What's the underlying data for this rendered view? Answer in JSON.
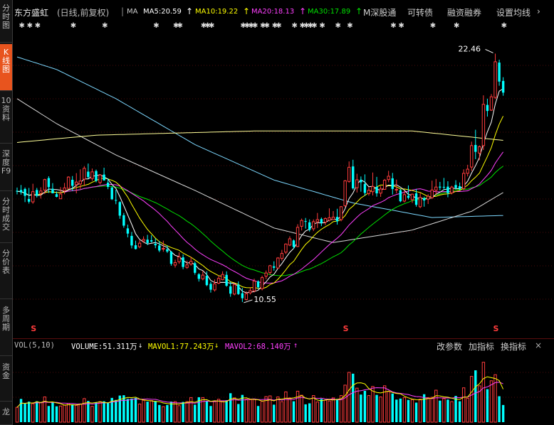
{
  "sidebar": {
    "tabs": [
      {
        "label": "分时图",
        "active": false
      },
      {
        "label": "K线图",
        "active": true
      },
      {
        "label": "10资料",
        "active": false
      },
      {
        "label": "深度F9",
        "active": false
      },
      {
        "label": "分时成交",
        "active": false
      },
      {
        "label": "分价表",
        "active": false
      },
      {
        "label": "多周期",
        "active": false
      },
      {
        "label": "资金",
        "active": false
      },
      {
        "label": "龙",
        "active": false
      }
    ]
  },
  "header": {
    "stock_name": "东方盛虹",
    "period": "(日线,前复权)",
    "ma_label": "MA",
    "ma5": "MA5:20.59",
    "ma10": "MA10:19.22",
    "ma20": "MA20:18.13",
    "ma30": "MA30:17.89",
    "ma5_arrow": "↑",
    "ma10_arrow": "↑",
    "ma20_arrow": "↑",
    "ma30_arrow": "↑",
    "menu_1": "M深股通",
    "menu_2": "可转债",
    "menu_3": "融资融券",
    "menu_4": "设置均线"
  },
  "volume_bar": {
    "label": "VOL(5,10)",
    "volume": "VOLUME:51.311万",
    "volume_arrow": "↓",
    "mavol1": "MAVOL1:77.243万",
    "mavol1_arrow": "↓",
    "mavol2": "MAVOL2:68.140万",
    "mavol2_arrow": "↑",
    "btn_params": "改参数",
    "btn_add": "加指标",
    "btn_switch": "换指标"
  },
  "colors": {
    "up": "#ff3c3c",
    "down": "#00ffff",
    "ma5": "#ffffff",
    "ma10": "#ffff00",
    "ma20": "#ff40ff",
    "ma30": "#00e000",
    "ma60": "#ffff99",
    "ma120": "#7dd8ff",
    "ma250": "#d8d8d8"
  },
  "chart_data": {
    "type": "candlestick",
    "title": "东方盛虹",
    "ylim": [
      9.9,
      23.6
    ],
    "annotations": [
      {
        "label": "22.46",
        "type": "high"
      },
      {
        "label": "10.55",
        "type": "low"
      }
    ],
    "s_markers": [
      "S",
      "S",
      "S"
    ],
    "candles": [
      [
        15.88,
        16.04,
        15.71,
        15.86
      ],
      [
        15.92,
        16.16,
        15.7,
        15.81
      ],
      [
        15.97,
        16.04,
        15.34,
        15.64
      ],
      [
        15.49,
        16.02,
        15.27,
        15.36
      ],
      [
        15.35,
        16.22,
        15.26,
        15.84
      ],
      [
        15.92,
        16.02,
        15.56,
        15.64
      ],
      [
        15.76,
        16.05,
        15.51,
        15.87
      ],
      [
        15.92,
        16.46,
        15.73,
        16.42
      ],
      [
        16.49,
        16.58,
        15.78,
        16.06
      ],
      [
        15.98,
        16.25,
        15.76,
        15.76
      ],
      [
        15.72,
        15.85,
        15.57,
        15.59
      ],
      [
        15.5,
        16.06,
        15.49,
        15.73
      ],
      [
        15.89,
        16.26,
        15.72,
        16.02
      ],
      [
        16.0,
        16.58,
        15.99,
        16.54
      ],
      [
        16.41,
        16.59,
        15.88,
        16.12
      ],
      [
        16.18,
        16.73,
        15.76,
        16.3
      ],
      [
        16.21,
        16.91,
        15.97,
        16.35
      ],
      [
        16.44,
        17.06,
        16.11,
        16.96
      ],
      [
        16.8,
        17.19,
        16.46,
        16.54
      ],
      [
        16.47,
        16.95,
        16.36,
        16.79
      ],
      [
        16.83,
        16.9,
        16.29,
        16.36
      ],
      [
        16.28,
        16.68,
        16.19,
        16.64
      ],
      [
        16.66,
        16.99,
        16.37,
        16.38
      ],
      [
        16.27,
        16.47,
        15.96,
        16.07
      ],
      [
        16.04,
        16.09,
        15.44,
        15.48
      ],
      [
        15.44,
        15.93,
        15.24,
        15.41
      ],
      [
        15.34,
        15.38,
        14.54,
        14.69
      ],
      [
        14.71,
        14.82,
        14.11,
        14.21
      ],
      [
        14.08,
        14.26,
        13.65,
        13.83
      ],
      [
        13.72,
        13.91,
        13.12,
        13.26
      ],
      [
        13.27,
        13.49,
        13.07,
        13.09
      ],
      [
        13.2,
        13.51,
        13.13,
        13.37
      ],
      [
        13.47,
        13.7,
        13.39,
        13.55
      ],
      [
        13.54,
        13.77,
        13.28,
        13.38
      ],
      [
        13.51,
        13.75,
        13.4,
        13.45
      ],
      [
        13.34,
        13.6,
        13.13,
        13.27
      ],
      [
        13.26,
        13.47,
        12.94,
        13.02
      ],
      [
        13.1,
        13.49,
        12.96,
        13.12
      ],
      [
        13.08,
        13.26,
        12.9,
        12.97
      ],
      [
        12.96,
        13.0,
        12.29,
        12.38
      ],
      [
        12.32,
        12.58,
        12.2,
        12.44
      ],
      [
        12.48,
        12.93,
        12.38,
        12.71
      ],
      [
        12.69,
        12.83,
        12.12,
        12.23
      ],
      [
        12.21,
        12.53,
        12.14,
        12.33
      ],
      [
        12.37,
        12.72,
        12.29,
        12.5
      ],
      [
        12.41,
        12.49,
        11.86,
        11.95
      ],
      [
        11.88,
        11.94,
        11.53,
        11.66
      ],
      [
        11.66,
        12.05,
        11.59,
        11.84
      ],
      [
        11.81,
        12.02,
        11.31,
        11.36
      ],
      [
        11.42,
        11.52,
        11.0,
        11.14
      ],
      [
        11.13,
        11.63,
        11.05,
        11.42
      ],
      [
        11.45,
        11.83,
        11.41,
        11.68
      ],
      [
        11.62,
        12.02,
        11.59,
        11.87
      ],
      [
        11.85,
        12.02,
        11.28,
        11.33
      ],
      [
        11.3,
        11.52,
        10.8,
        10.95
      ],
      [
        10.93,
        11.45,
        10.87,
        11.39
      ],
      [
        11.38,
        11.54,
        10.89,
        10.93
      ],
      [
        10.97,
        11.22,
        10.55,
        10.73
      ],
      [
        10.67,
        11.06,
        10.62,
        10.95
      ],
      [
        10.99,
        11.26,
        10.91,
        11.09
      ],
      [
        11.08,
        11.67,
        11.01,
        11.55
      ],
      [
        11.54,
        11.59,
        11.17,
        11.26
      ],
      [
        11.19,
        11.81,
        11.11,
        11.72
      ],
      [
        11.79,
        12.06,
        11.65,
        11.94
      ],
      [
        11.96,
        12.33,
        11.86,
        12.29
      ],
      [
        12.26,
        12.5,
        12.05,
        12.19
      ],
      [
        12.18,
        12.7,
        12.14,
        12.66
      ],
      [
        12.64,
        13.05,
        12.53,
        12.88
      ],
      [
        12.94,
        13.36,
        12.85,
        13.33
      ],
      [
        13.28,
        13.7,
        13.23,
        13.58
      ],
      [
        13.5,
        13.55,
        13.1,
        13.19
      ],
      [
        13.21,
        14.28,
        13.18,
        14.13
      ],
      [
        14.18,
        14.55,
        13.98,
        14.46
      ],
      [
        14.43,
        14.58,
        14.07,
        14.42
      ],
      [
        14.37,
        14.51,
        13.93,
        14.01
      ],
      [
        14.06,
        14.51,
        13.95,
        14.4
      ],
      [
        14.4,
        14.82,
        14.1,
        14.5
      ],
      [
        14.53,
        14.6,
        14.19,
        14.34
      ],
      [
        14.38,
        14.61,
        14.24,
        14.55
      ],
      [
        14.47,
        15.04,
        14.41,
        14.59
      ],
      [
        14.51,
        14.91,
        14.49,
        14.62
      ],
      [
        14.63,
        15.02,
        14.26,
        14.42
      ],
      [
        14.5,
        15.15,
        14.42,
        15.12
      ],
      [
        15.17,
        16.4,
        15.1,
        16.36
      ],
      [
        16.33,
        17.29,
        16.27,
        17.01
      ],
      [
        17.05,
        17.37,
        15.94,
        16.0
      ],
      [
        16.03,
        16.7,
        15.8,
        16.41
      ],
      [
        16.41,
        16.57,
        15.84,
        16.29
      ],
      [
        16.21,
        16.67,
        15.65,
        15.78
      ],
      [
        15.75,
        16.06,
        15.65,
        15.91
      ],
      [
        15.84,
        16.76,
        15.66,
        16.09
      ],
      [
        16.07,
        16.55,
        15.6,
        15.76
      ],
      [
        15.77,
        16.1,
        15.59,
        15.97
      ],
      [
        15.95,
        16.45,
        15.93,
        16.39
      ],
      [
        16.42,
        16.84,
        16.29,
        16.58
      ],
      [
        16.48,
        16.74,
        15.7,
        15.97
      ],
      [
        15.94,
        16.42,
        15.76,
        15.95
      ],
      [
        15.91,
        15.97,
        15.33,
        15.38
      ],
      [
        15.39,
        15.9,
        15.32,
        15.7
      ],
      [
        15.64,
        16.14,
        15.47,
        15.55
      ],
      [
        15.46,
        15.75,
        15.3,
        15.72
      ],
      [
        15.76,
        15.97,
        15.12,
        15.21
      ],
      [
        15.12,
        15.79,
        15.05,
        15.56
      ],
      [
        15.52,
        15.6,
        15.12,
        15.42
      ],
      [
        15.48,
        15.72,
        15.25,
        15.62
      ],
      [
        15.55,
        16.37,
        15.5,
        15.92
      ],
      [
        15.91,
        16.45,
        15.69,
        16.06
      ],
      [
        16.08,
        16.31,
        15.91,
        16.04
      ],
      [
        16.07,
        16.5,
        15.93,
        16.06
      ],
      [
        16.08,
        16.34,
        15.57,
        15.77
      ],
      [
        15.78,
        16.12,
        15.71,
        16.06
      ],
      [
        16.16,
        16.39,
        15.95,
        16.02
      ],
      [
        16.1,
        16.28,
        15.91,
        15.98
      ],
      [
        15.99,
        16.91,
        15.91,
        16.72
      ],
      [
        16.72,
        17.13,
        16.57,
        16.92
      ],
      [
        17.02,
        18.24,
        16.83,
        18.05
      ],
      [
        18.08,
        18.81,
        17.4,
        17.75
      ],
      [
        17.69,
        18.06,
        17.35,
        18.0
      ],
      [
        18.05,
        20.46,
        17.84,
        20.03
      ],
      [
        20.0,
        20.3,
        19.44,
        19.71
      ],
      [
        19.75,
        20.52,
        19.71,
        20.39
      ],
      [
        20.36,
        22.46,
        20.28,
        22.07
      ],
      [
        22.03,
        22.17,
        20.92,
        21.12
      ],
      [
        21.15,
        21.33,
        20.44,
        20.59
      ]
    ],
    "volumes": [
      [
        44,
        0
      ],
      [
        69,
        1
      ],
      [
        55,
        1
      ],
      [
        61,
        1
      ],
      [
        55,
        0
      ],
      [
        62,
        1
      ],
      [
        58,
        0
      ],
      [
        75,
        0
      ],
      [
        48,
        1
      ],
      [
        58,
        1
      ],
      [
        47,
        1
      ],
      [
        48,
        0
      ],
      [
        51,
        0
      ],
      [
        56,
        0
      ],
      [
        53,
        1
      ],
      [
        50,
        0
      ],
      [
        54,
        0
      ],
      [
        70,
        0
      ],
      [
        63,
        1
      ],
      [
        47,
        0
      ],
      [
        59,
        1
      ],
      [
        61,
        0
      ],
      [
        62,
        1
      ],
      [
        57,
        1
      ],
      [
        72,
        1
      ],
      [
        66,
        1
      ],
      [
        79,
        1
      ],
      [
        80,
        1
      ],
      [
        69,
        1
      ],
      [
        70,
        1
      ],
      [
        72,
        1
      ],
      [
        54,
        0
      ],
      [
        65,
        0
      ],
      [
        61,
        1
      ],
      [
        64,
        0
      ],
      [
        63,
        1
      ],
      [
        51,
        1
      ],
      [
        46,
        0
      ],
      [
        51,
        1
      ],
      [
        61,
        1
      ],
      [
        61,
        0
      ],
      [
        49,
        0
      ],
      [
        60,
        1
      ],
      [
        61,
        0
      ],
      [
        73,
        0
      ],
      [
        52,
        1
      ],
      [
        74,
        1
      ],
      [
        73,
        0
      ],
      [
        62,
        1
      ],
      [
        48,
        1
      ],
      [
        61,
        0
      ],
      [
        68,
        0
      ],
      [
        63,
        0
      ],
      [
        65,
        1
      ],
      [
        86,
        1
      ],
      [
        72,
        0
      ],
      [
        54,
        1
      ],
      [
        81,
        1
      ],
      [
        68,
        0
      ],
      [
        67,
        0
      ],
      [
        68,
        0
      ],
      [
        48,
        1
      ],
      [
        62,
        0
      ],
      [
        76,
        0
      ],
      [
        78,
        0
      ],
      [
        52,
        1
      ],
      [
        75,
        0
      ],
      [
        61,
        0
      ],
      [
        90,
        0
      ],
      [
        72,
        0
      ],
      [
        62,
        1
      ],
      [
        92,
        0
      ],
      [
        80,
        0
      ],
      [
        53,
        1
      ],
      [
        56,
        1
      ],
      [
        79,
        0
      ],
      [
        60,
        0
      ],
      [
        69,
        1
      ],
      [
        65,
        0
      ],
      [
        63,
        0
      ],
      [
        72,
        0
      ],
      [
        69,
        1
      ],
      [
        79,
        0
      ],
      [
        110,
        0
      ],
      [
        148,
        0
      ],
      [
        144,
        1
      ],
      [
        101,
        0
      ],
      [
        82,
        1
      ],
      [
        93,
        1
      ],
      [
        79,
        0
      ],
      [
        106,
        0
      ],
      [
        81,
        1
      ],
      [
        75,
        0
      ],
      [
        108,
        0
      ],
      [
        91,
        0
      ],
      [
        85,
        1
      ],
      [
        67,
        1
      ],
      [
        70,
        1
      ],
      [
        73,
        0
      ],
      [
        66,
        1
      ],
      [
        67,
        0
      ],
      [
        58,
        1
      ],
      [
        68,
        0
      ],
      [
        83,
        1
      ],
      [
        73,
        0
      ],
      [
        74,
        0
      ],
      [
        95,
        0
      ],
      [
        64,
        1
      ],
      [
        70,
        0
      ],
      [
        67,
        1
      ],
      [
        61,
        0
      ],
      [
        78,
        1
      ],
      [
        62,
        1
      ],
      [
        102,
        0
      ],
      [
        71,
        0
      ],
      [
        136,
        0
      ],
      [
        154,
        1
      ],
      [
        108,
        0
      ],
      [
        178,
        0
      ],
      [
        98,
        1
      ],
      [
        123,
        0
      ],
      [
        141,
        0
      ],
      [
        77,
        1
      ],
      [
        51,
        1
      ]
    ]
  }
}
